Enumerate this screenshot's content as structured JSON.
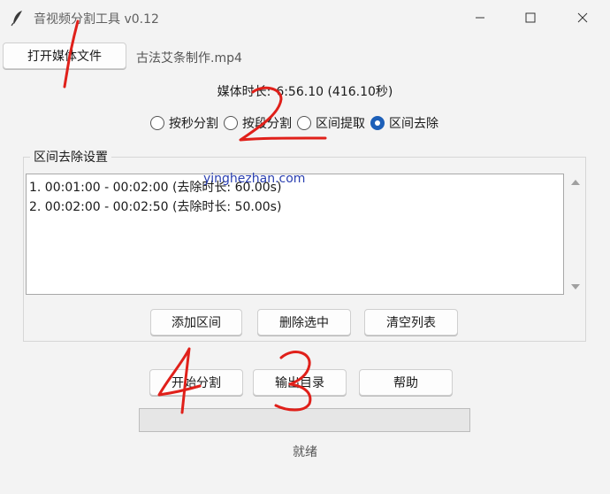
{
  "window": {
    "title": "音视频分割工具 v0.12",
    "icon": "feather-icon"
  },
  "file": {
    "open_button": "打开媒体文件",
    "name": "古法艾条制作.mp4"
  },
  "media": {
    "duration_label": "媒体时长:",
    "duration_value": "6:56.10 (416.10秒)"
  },
  "modes": [
    {
      "label": "按秒分割",
      "checked": false
    },
    {
      "label": "按段分割",
      "checked": false
    },
    {
      "label": "区间提取",
      "checked": false
    },
    {
      "label": "区间去除",
      "checked": true
    }
  ],
  "section": {
    "title": "区间去除设置",
    "rows": [
      "1. 00:01:00 - 00:02:00 (去除时长: 60.00s)",
      "2. 00:02:00 - 00:02:50 (去除时长: 50.00s)"
    ],
    "add_button": "添加区间",
    "delete_button": "删除选中",
    "clear_button": "清空列表"
  },
  "actions": {
    "start_button": "开始分割",
    "output_button": "输出目录",
    "help_button": "帮助"
  },
  "progress": {
    "fraction": 0
  },
  "status": "就绪",
  "watermark": "yinghezhan.com",
  "annotations": [
    "1",
    "2",
    "3",
    "4"
  ],
  "colors": {
    "accent": "#1d5fb8",
    "annotation": "#e0201a",
    "background": "#f3f3f3"
  }
}
